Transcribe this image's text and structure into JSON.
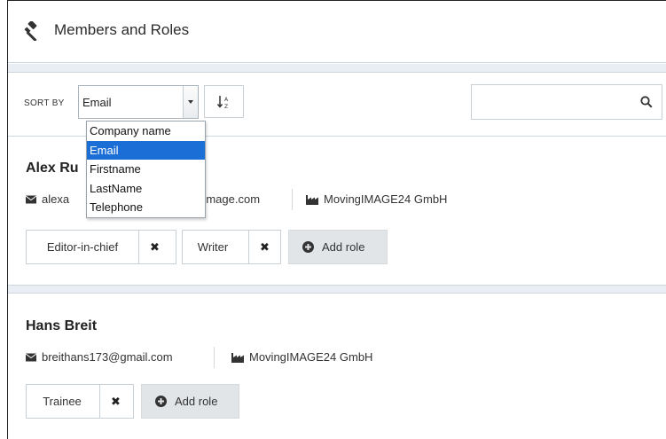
{
  "page": {
    "title": "Members and Roles"
  },
  "toolbar": {
    "sort_label": "SORT BY",
    "sort_selected": "Email",
    "sort_options": [
      "Company name",
      "Email",
      "Firstname",
      "LastName",
      "Telephone"
    ],
    "search_value": ""
  },
  "members": [
    {
      "name": "Alex Ru",
      "email": "alexa",
      "email_tail": "ngimage.com",
      "company": "MovingIMAGE24 GmbH",
      "roles": [
        "Editor-in-chief",
        "Writer"
      ],
      "add_role_label": "Add role"
    },
    {
      "name": "Hans Breit",
      "email": "breithans173@gmail.com",
      "company": "MovingIMAGE24 GmbH",
      "roles": [
        "Trainee"
      ],
      "add_role_label": "Add role"
    }
  ],
  "icons": {
    "header": "gavel-icon",
    "email": "envelope-icon",
    "company": "factory-icon",
    "sort_direction": "sort-alpha-icon",
    "search": "search-icon",
    "remove": "close-icon",
    "add": "plus-circle-icon"
  },
  "colors": {
    "selected_option": "#1a6ed6",
    "add_role_bg": "#e2e5e8",
    "section_band": "#e8eef3"
  }
}
